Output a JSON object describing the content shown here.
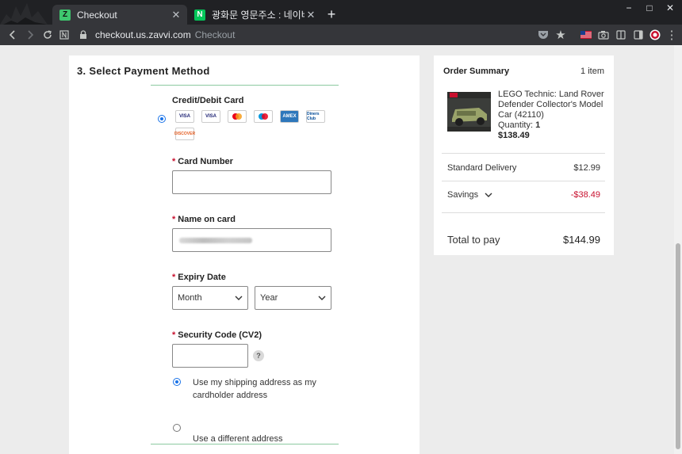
{
  "browser": {
    "tabs": [
      {
        "label": "Checkout",
        "favicon": "Z"
      },
      {
        "label": "광화문 영문주소 : 네이버 통합검",
        "favicon": "N"
      }
    ],
    "url_host": "checkout.us.zavvi.com",
    "url_path": "Checkout",
    "window_buttons": [
      "−",
      "□",
      "✕"
    ]
  },
  "payment": {
    "title": "3. Select Payment Method",
    "method_label": "Credit/Debit Card",
    "card_logos": [
      "VISA",
      "VISA",
      "mastercard",
      "maestro",
      "AMEX",
      "Diners Club",
      "DISCOVER"
    ],
    "required_mark": "*",
    "card_number_label": "Card Number",
    "card_number_value": "",
    "name_label": "Name on card",
    "expiry_label": "Expiry Date",
    "month_value": "Month",
    "year_value": "Year",
    "cv2_label": "Security Code (CV2)",
    "cv2_value": "",
    "help_glyph": "?",
    "address_option_1": "Use my shipping address as my cardholder address",
    "address_option_2": "Use a different address"
  },
  "summary": {
    "title": "Order Summary",
    "item_count": "1 item",
    "product_name": "LEGO Technic: Land Rover Defender Collector's Model Car (42110)",
    "quantity_label": "Quantity:",
    "quantity_value": "1",
    "product_price": "$138.49",
    "delivery_label": "Standard Delivery",
    "delivery_value": "$12.99",
    "savings_label": "Savings",
    "savings_value": "-$38.49",
    "total_label": "Total to pay",
    "total_value": "$144.99"
  },
  "colors": {
    "accent_green": "#8cc9a0",
    "required_red": "#c8102e",
    "chrome_dark": "#202124"
  }
}
